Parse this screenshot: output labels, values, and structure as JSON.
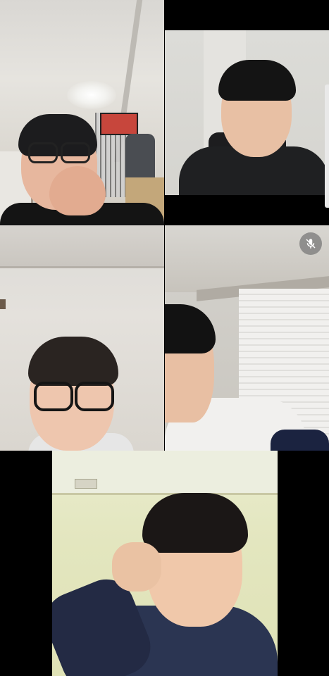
{
  "participants": [
    {
      "position": "top-left",
      "muted": false
    },
    {
      "position": "top-right",
      "muted": false
    },
    {
      "position": "middle-left",
      "muted": false
    },
    {
      "position": "middle-right",
      "muted": true,
      "mute_icon": "mic-off-icon"
    },
    {
      "position": "bottom-center",
      "muted": false
    }
  ]
}
